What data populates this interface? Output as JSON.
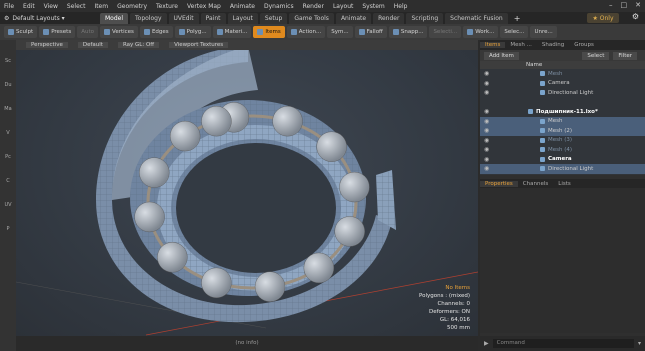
{
  "menu": [
    "File",
    "Edit",
    "View",
    "Select",
    "Item",
    "Geometry",
    "Texture",
    "Vertex Map",
    "Animate",
    "Dynamics",
    "Render",
    "Layout",
    "System",
    "Help"
  ],
  "layouts_label": "Default Layouts ▾",
  "layout_tabs": [
    "Model",
    "Topology",
    "UVEdit",
    "Paint",
    "Layout",
    "Setup",
    "Game Tools",
    "Animate",
    "Render",
    "Scripting",
    "Schematic Fusion"
  ],
  "only_label": "★ Only",
  "toolbar": {
    "sculpt": "Sculpt",
    "presets": "Presets",
    "auto": "Auto",
    "vertices": "Vertices",
    "edges": "Edges",
    "polygons": "Polyg...",
    "materials": "Materi...",
    "items": "Items",
    "action": "Action...",
    "sym": "Sym...",
    "falloff": "Falloff",
    "snap": "Snapp...",
    "select": "Selecti...",
    "work": "Work...",
    "selec": "Selec...",
    "unre": "Unre..."
  },
  "left_tabs": [
    "Sc",
    "Du",
    "Ma",
    "V",
    "Pc",
    "C",
    "UV",
    "P"
  ],
  "viewport": {
    "view": "Perspective",
    "shading": "Default",
    "raygl": "Ray GL: Off",
    "textures": "Viewport Textures",
    "info": {
      "selection": "No Items",
      "polygons": "Polygons : (mixed)",
      "channels": "Channels: 0",
      "deformers": "Deformers: ON",
      "gl": "GL: 64,016",
      "size": "500 mm"
    }
  },
  "status_bar": "(no info)",
  "right_panel": {
    "tabs": [
      "Items",
      "Mesh ...",
      "Shading",
      "Groups"
    ],
    "add_item": "Add Item",
    "select": "Select",
    "filter": "Filter",
    "col_name": "Name",
    "tree": [
      {
        "label": "Mesh",
        "indent": 3,
        "dim": true,
        "bold": false
      },
      {
        "label": "Camera",
        "indent": 3,
        "dim": false,
        "bold": false
      },
      {
        "label": "Directional Light",
        "indent": 3,
        "dim": false,
        "bold": false
      },
      {
        "label": "",
        "indent": 0,
        "dim": false,
        "bold": false
      },
      {
        "label": "Подшипник-11.lxo*",
        "indent": 1,
        "dim": false,
        "bold": true
      },
      {
        "label": "Mesh",
        "indent": 3,
        "dim": false,
        "bold": false
      },
      {
        "label": "Mesh (2)",
        "indent": 3,
        "dim": false,
        "bold": false
      },
      {
        "label": "Mesh (3)",
        "indent": 3,
        "dim": true,
        "bold": false
      },
      {
        "label": "Mesh (4)",
        "indent": 3,
        "dim": true,
        "bold": false
      },
      {
        "label": "Camera",
        "indent": 3,
        "dim": false,
        "bold": true
      },
      {
        "label": "Directional Light",
        "indent": 3,
        "dim": false,
        "bold": false
      }
    ],
    "bottom_tabs": [
      "Properties",
      "Channels",
      "Lists"
    ],
    "command": "Command"
  },
  "colors": {
    "accent": "#e08a1e",
    "selection": "#4a5f7a",
    "model": "#8fa6c2"
  }
}
